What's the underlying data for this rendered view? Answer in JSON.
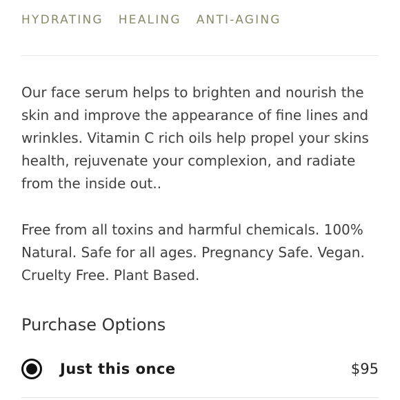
{
  "tags": [
    "HYDRATING",
    "HEALING",
    "ANTI-AGING"
  ],
  "description": {
    "paragraph_1": "Our face serum helps to brighten and nourish the skin and improve the appearance of fine lines and wrinkles. Vitamin C rich oils help propel your skins health, rejuvenate your complexion, and radiate from the inside out..",
    "paragraph_2": "Free from all toxins and harmful chemicals. 100% Natural. Safe for all ages. Pregnancy Safe. Vegan. Cruelty Free. Plant Based."
  },
  "purchase": {
    "title": "Purchase Options",
    "options": [
      {
        "label": "Just this once",
        "price": "$95",
        "selected": true
      }
    ]
  },
  "colors": {
    "tag_text": "#8a8a6a",
    "body_text": "#3f3f3f",
    "radio": "#111111"
  }
}
